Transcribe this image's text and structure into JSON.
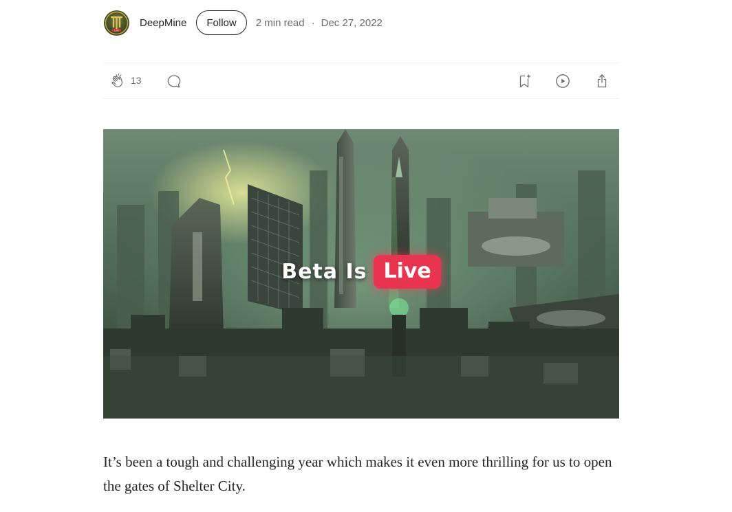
{
  "author": {
    "name": "DeepMine",
    "avatar_text": "LIVE",
    "follow_label": "Follow",
    "read_time": "2 min read",
    "separator": "·",
    "date": "Dec 27, 2022"
  },
  "actions": {
    "clap_count": "13",
    "icons": [
      "clap-icon",
      "response-icon",
      "bookmark-icon",
      "listen-icon",
      "share-icon"
    ]
  },
  "hero": {
    "title_part1": "Beta Is",
    "title_part2": "Live",
    "accent_color": "#e8344e"
  },
  "article": {
    "paragraph": "It’s been a tough and challenging year which makes it even more thrilling for us to open the gates of Shelter City."
  }
}
